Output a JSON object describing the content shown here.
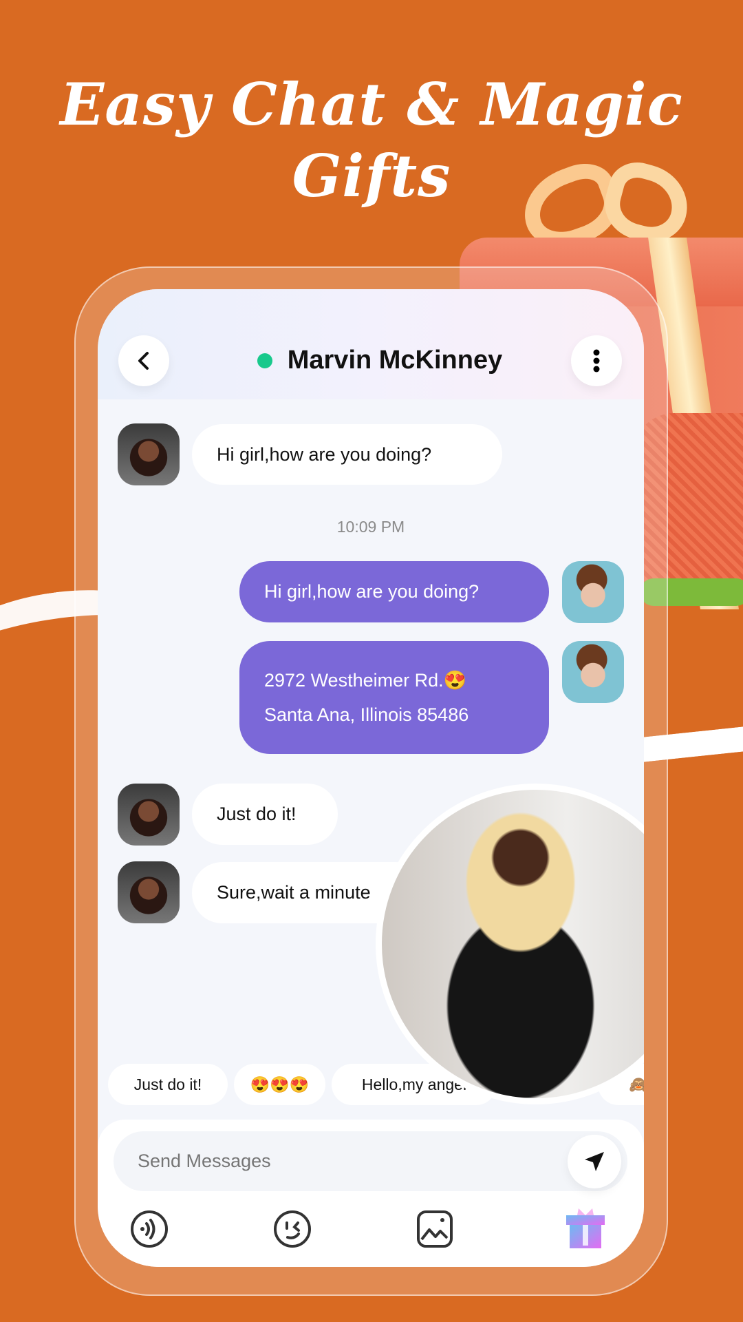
{
  "headline": {
    "line1": "Easy Chat & Magic",
    "line2": "Gifts"
  },
  "colors": {
    "background": "#D96A22",
    "accent_purple": "#7B68D8",
    "online": "#18C98C"
  },
  "chat": {
    "contact_name": "Marvin McKinney",
    "online": true,
    "back_icon": "chevron-left-icon",
    "menu_icon": "more-vertical-icon",
    "messages": [
      {
        "from": "them",
        "text": "Hi girl,how are you doing?"
      },
      {
        "type": "timestamp",
        "text": "10:09 PM"
      },
      {
        "from": "me",
        "text": "Hi girl,how are you doing?"
      },
      {
        "from": "me",
        "line1": "2972 Westheimer Rd.😍",
        "line2": "Santa Ana, Illinois 85486"
      },
      {
        "from": "them",
        "text": "Just do it!"
      },
      {
        "from": "them",
        "text": "Sure,wait a minute"
      }
    ],
    "quick_replies": [
      "Just do it!",
      "😍😍😍",
      "Hello,my angel",
      "🙈"
    ],
    "input_placeholder": "Send Messages",
    "toolbar": [
      "voice-icon",
      "emoji-wink-icon",
      "image-icon",
      "gift-icon"
    ]
  }
}
